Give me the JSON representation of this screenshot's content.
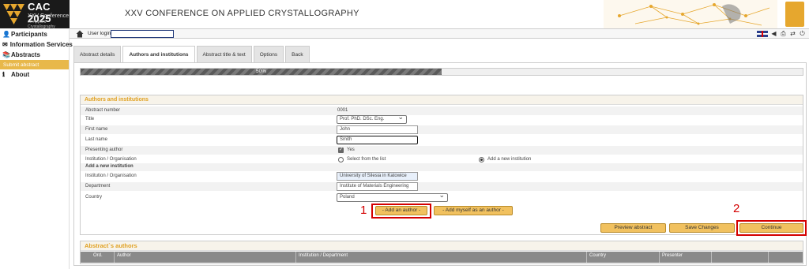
{
  "logo": {
    "big": "CAC 2025",
    "line1": "XXV Conference",
    "line2": "on Applied Crystallography"
  },
  "sidebar": {
    "items": [
      {
        "label": "Participants",
        "icon": "user-icon"
      },
      {
        "label": "Information Services",
        "icon": "envelope-icon"
      },
      {
        "label": "Abstracts",
        "icon": "abstracts-icon"
      }
    ],
    "sub_active": "Submit abstract",
    "about": "About"
  },
  "header": {
    "title": "XXV CONFERENCE ON APPLIED CRYSTALLOGRAPHY",
    "user_label": "User login",
    "user_value": ""
  },
  "tabs": [
    {
      "label": "Abstract details",
      "active": false
    },
    {
      "label": "Authors and institutions",
      "active": true
    },
    {
      "label": "Abstract title & text",
      "active": false
    },
    {
      "label": "Options",
      "active": false
    },
    {
      "label": "Back",
      "active": false
    }
  ],
  "progress": {
    "percent": 50,
    "label": "50%"
  },
  "form": {
    "section_title": "Authors and institutions",
    "abstract_number_label": "Abstract number",
    "abstract_number": "0001",
    "title_label": "Title",
    "title_value": "Prof. PhD. DSc. Eng.",
    "first_name_label": "First name",
    "first_name": "John",
    "last_name_label": "Last name",
    "last_name": "Smith",
    "presenting_label": "Presenting author",
    "presenting_value": "Yes",
    "institution_label": "Institution / Organisation",
    "option_select": "Select from the list",
    "option_new": "Add a new institution",
    "add_new_heading": "Add a new institution",
    "institution_field_label": "Institution / Organisation",
    "institution_value": "University of Silesia in Katowice",
    "department_label": "Department",
    "department_value": "Institute of Materials Engineering",
    "country_label": "Country",
    "country_value": "Poland"
  },
  "buttons": {
    "add_author": "- Add an author -",
    "add_myself": "- Add myself as an author -",
    "preview": "Preview abstract",
    "save": "Save Changes",
    "continue": "Continue"
  },
  "annotations": {
    "one": "1",
    "two": "2"
  },
  "authors_table": {
    "title": "Abstract`s authors",
    "columns": [
      "Ord.",
      "Author",
      "Institution / Department",
      "Country",
      "Presenter"
    ]
  },
  "colors": {
    "accent": "#e0a020",
    "button": "#f1c15f",
    "highlight": "#d40000"
  }
}
